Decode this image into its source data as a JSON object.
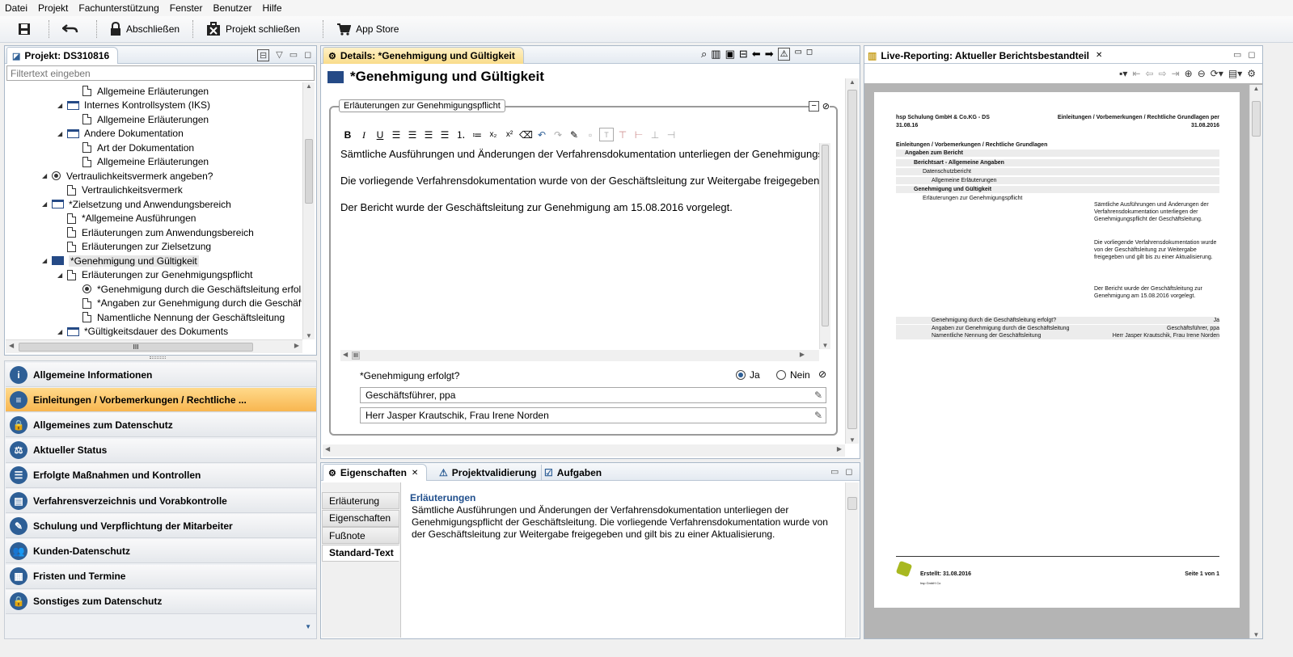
{
  "menu": [
    "Datei",
    "Projekt",
    "Fachunterstützung",
    "Fenster",
    "Benutzer",
    "Hilfe"
  ],
  "toolbar": {
    "lock": "Abschließen",
    "close_project": "Projekt schließen",
    "app_store": "App Store"
  },
  "project_panel": {
    "title": "Projekt: DS310816",
    "filter_placeholder": "Filtertext eingeben",
    "tree": [
      {
        "label": "Allgemeine Erläuterungen",
        "indent": 5,
        "icon": "doc",
        "arrow": ""
      },
      {
        "label": "Internes Kontrollsystem (IKS)",
        "indent": 4,
        "icon": "folder",
        "arrow": "▲"
      },
      {
        "label": "Allgemeine Erläuterungen",
        "indent": 5,
        "icon": "doc",
        "arrow": ""
      },
      {
        "label": "Andere Dokumentation",
        "indent": 4,
        "icon": "folder",
        "arrow": "▲"
      },
      {
        "label": "Art der Dokumentation",
        "indent": 5,
        "icon": "doc",
        "arrow": ""
      },
      {
        "label": "Allgemeine Erläuterungen",
        "indent": 5,
        "icon": "doc",
        "arrow": ""
      },
      {
        "label": "Vertraulichkeitsvermerk angeben?",
        "indent": 3,
        "icon": "radio",
        "arrow": "▲"
      },
      {
        "label": "Vertraulichkeitsvermerk",
        "indent": 4,
        "icon": "doc",
        "arrow": ""
      },
      {
        "label": "*Zielsetzung und Anwendungsbereich",
        "indent": 3,
        "icon": "folder",
        "arrow": "▲"
      },
      {
        "label": "*Allgemeine Ausführungen",
        "indent": 4,
        "icon": "doc",
        "arrow": ""
      },
      {
        "label": "Erläuterungen zum Anwendungsbereich",
        "indent": 4,
        "icon": "doc",
        "arrow": ""
      },
      {
        "label": "Erläuterungen zur Zielsetzung",
        "indent": 4,
        "icon": "doc",
        "arrow": ""
      },
      {
        "label": "*Genehmigung und Gültigkeit",
        "indent": 3,
        "icon": "folder-open",
        "arrow": "▲",
        "selected": true
      },
      {
        "label": "Erläuterungen zur Genehmigungspflicht",
        "indent": 4,
        "icon": "doc",
        "arrow": "▲"
      },
      {
        "label": "*Genehmigung durch die Geschäftsleitung erfol",
        "indent": 5,
        "icon": "radio",
        "arrow": ""
      },
      {
        "label": "*Angaben zur Genehmigung durch die Geschäft",
        "indent": 5,
        "icon": "doc",
        "arrow": ""
      },
      {
        "label": "Namentliche Nennung der Geschäftsleitung",
        "indent": 5,
        "icon": "doc",
        "arrow": ""
      },
      {
        "label": "*Gültigkeitsdauer des Dokuments",
        "indent": 4,
        "icon": "folder",
        "arrow": "▲"
      }
    ],
    "hscroll_label": "III"
  },
  "nav": [
    {
      "label": "Allgemeine Informationen",
      "icon": "i"
    },
    {
      "label": "Einleitungen / Vorbemerkungen / Rechtliche ...",
      "icon": "≡",
      "active": true
    },
    {
      "label": "Allgemeines zum Datenschutz",
      "icon": "🔒"
    },
    {
      "label": "Aktueller Status",
      "icon": "⚖"
    },
    {
      "label": "Erfolgte Maßnahmen und Kontrollen",
      "icon": "☰"
    },
    {
      "label": "Verfahrensverzeichnis und Vorabkontrolle",
      "icon": "▤"
    },
    {
      "label": "Schulung und Verpflichtung der Mitarbeiter",
      "icon": "✎"
    },
    {
      "label": "Kunden-Datenschutz",
      "icon": "👥"
    },
    {
      "label": "Fristen und Termine",
      "icon": "▦"
    },
    {
      "label": "Sonstiges zum Datenschutz",
      "icon": "🔒"
    }
  ],
  "details": {
    "tab": "Details: *Genehmigung und Gültigkeit",
    "heading": "*Genehmigung und Gültigkeit",
    "group_title": "Erläuterungen zur Genehmigungspflicht",
    "paragraphs": [
      "Sämtliche Ausführungen und Änderungen der Verfahrensdokumentation unterliegen der Genehmigungspflicht der Geschäftsleitung.",
      "Die vorliegende Verfahrensdokumentation wurde von der Geschäftsleitung zur Weitergabe freigegeben und gilt bis zu einer Aktualisierung.",
      "Der Bericht wurde der Geschäftsleitung zur Genehmigung am 15.08.2016 vorgelegt."
    ],
    "hscroll_label": "III",
    "question": "*Genehmigung erfolgt?",
    "opt_yes": "Ja",
    "opt_no": "Nein",
    "field1": "Geschäftsführer, ppa",
    "field2": "Herr Jasper Krautschik, Frau Irene Norden"
  },
  "props": {
    "tabs": [
      "Eigenschaften",
      "Projektvalidierung",
      "Aufgaben"
    ],
    "side_tabs": [
      "Erläuterung",
      "Eigenschaften",
      "Fußnote",
      "Standard-Text"
    ],
    "heading": "Erläuterungen",
    "text": "Sämtliche Ausführungen und Änderungen der Verfahrensdokumentation unterliegen der Genehmigungspflicht der Geschäftsleitung. Die vorliegende Verfahrensdokumentation wurde von der Geschäftsleitung zur Weitergabe freigegeben und gilt bis zu einer Aktualisierung."
  },
  "report": {
    "tab": "Live-Reporting: Aktueller Berichtsbestandteil",
    "company": "hsp Schulung GmbH & Co.KG - DS",
    "date_left": "31.08.16",
    "header_right": "Einleitungen / Vorbemerkungen / Rechtliche Grundlagen per",
    "date_right": "31.08.2016",
    "section": "Einleitungen / Vorbemerkungen / Rechtliche Grundlagen",
    "rows": [
      {
        "t": "Angaben zum Bericht",
        "lvl": 1,
        "bold": true
      },
      {
        "t": "Berichtsart - Allgemeine Angaben",
        "lvl": 2,
        "bold": true
      },
      {
        "t": "Datenschutzbericht",
        "lvl": 3
      },
      {
        "t": "Allgemeine Erläuterungen",
        "lvl": 4
      },
      {
        "t": "Genehmigung und Gültigkeit",
        "lvl": 2,
        "bold": true
      },
      {
        "t": "Erläuterungen zur Genehmigungspflicht",
        "lvl": 3
      }
    ],
    "para1": "Sämtliche Ausführungen und Änderungen der Verfahrensdokumentation unterliegen der Genehmigungspflicht der Geschäftsleitung.",
    "para2": "Die vorliegende Verfahrensdokumentation wurde von der Geschäftsleitung zur Weitergabe freigegeben und gilt bis zu einer Aktualisierung.",
    "para3": "Der Bericht wurde der Geschäftsleitung zur Genehmigung am 15.08.2016 vorgelegt.",
    "kv": [
      {
        "k": "Genehmigung durch die Geschäftsleitung erfolgt?",
        "v": "Ja"
      },
      {
        "k": "Angaben zur Genehmigung durch die Geschäftsleitung",
        "v": "Geschäftsführer, ppa"
      },
      {
        "k": "Namentliche Nennung der Geschäftsleitung",
        "v": "Herr Jasper Krautschik, Frau Irene Norden"
      }
    ],
    "footer_created": "Erstellt: 31.08.2016",
    "footer_page": "Seite 1 von 1",
    "footer_small": "hsp GmbH Co"
  },
  "colors": {
    "accent": "#f8b650",
    "brand": "#2e5f96",
    "selection": "#cce8ff"
  }
}
